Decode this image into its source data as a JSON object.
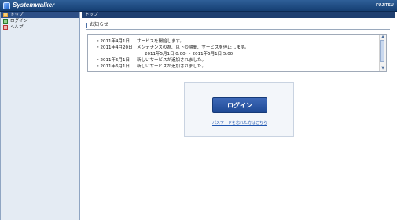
{
  "app": {
    "brand": "Systemwalker",
    "vendor": "FUJITSU"
  },
  "sidebar": {
    "items": [
      {
        "label": "トップ",
        "active": true
      },
      {
        "label": "ログイン",
        "active": false
      },
      {
        "label": "ヘルプ",
        "active": false
      }
    ]
  },
  "main": {
    "header": "トップ",
    "panel_title": "お知らせ",
    "notices": [
      {
        "date": "・2011年4月1日",
        "text": "サービスを開始します。"
      },
      {
        "date": "・2011年4月20日",
        "text": "メンテナンスの為、以下の期間、サービスを停止します。",
        "detail": "2011年5月1日 0:00 〜 2011年5月1日 5:00"
      },
      {
        "date": "・2011年5月1日",
        "text": "新しいサービスが追加されました。"
      },
      {
        "date": "・2011年6月1日",
        "text": "新しいサービスが追加されました。"
      }
    ]
  },
  "login": {
    "button_label": "ログイン",
    "forgot_link": "パスワードを忘れた方はこちら"
  }
}
